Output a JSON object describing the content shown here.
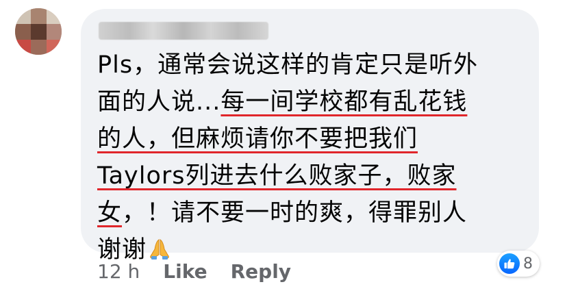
{
  "comment": {
    "lines": [
      {
        "pre": "Pls，通常会说这样的肯定只是听外",
        "mark": ""
      },
      {
        "pre": "面的人说...",
        "mark": "每一间学校都有乱花钱"
      },
      {
        "pre": "",
        "mark": "的人，但麻烦请你不要把我们"
      },
      {
        "pre": "",
        "mark": "Taylors列进去什么败家子，败家"
      },
      {
        "pre": "",
        "mark": "女",
        "post": "，！请不要一时的爽，得罪别人"
      },
      {
        "pre": "谢谢",
        "mark": ""
      }
    ],
    "emoji": "folded-hands-icon",
    "underline_color": "#e0262b"
  },
  "meta": {
    "time": "12 h",
    "like_label": "Like",
    "reply_label": "Reply"
  },
  "reactions": {
    "icon": "thumbs-up-icon",
    "count": "8",
    "badge_color": "#0866ff"
  },
  "colors": {
    "bubble": "#f0f2f5",
    "text": "#050505",
    "meta": "#65676b"
  }
}
